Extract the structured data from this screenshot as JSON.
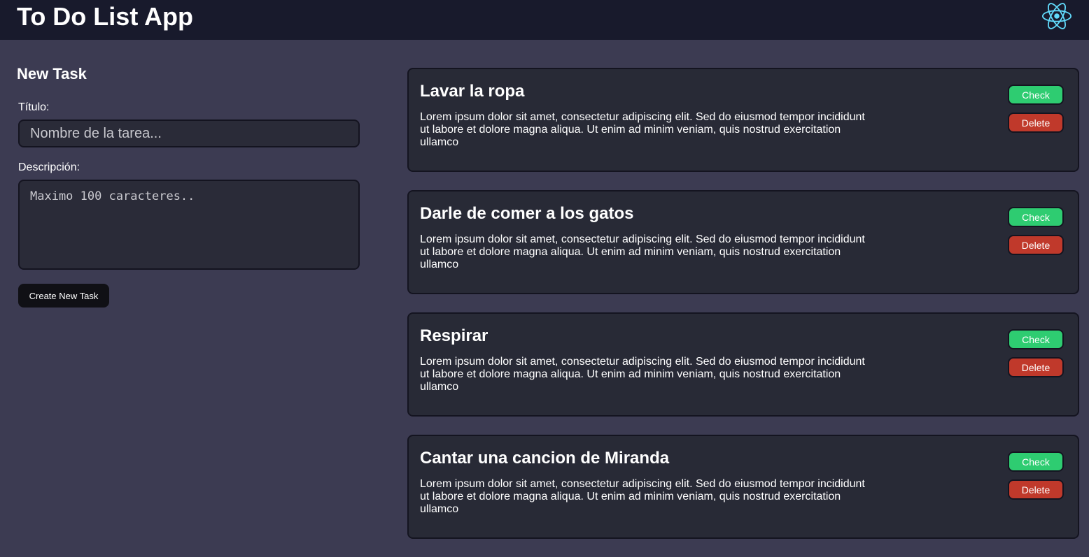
{
  "header": {
    "title": "To Do List App",
    "logo_icon": "react-logo-icon",
    "logo_color": "#61dafb",
    "background": "#181a2c"
  },
  "new_task": {
    "heading": "New Task",
    "title_label": "Título:",
    "title_placeholder": "Nombre de la tarea...",
    "title_value": "",
    "description_label": "Descripción:",
    "description_placeholder": "Maximo 100 caracteres..",
    "description_value": "",
    "create_button_label": "Create New Task"
  },
  "tasks": [
    {
      "title": "Lavar la ropa",
      "description": "Lorem ipsum dolor sit amet, consectetur adipiscing elit. Sed do eiusmod tempor incididunt ut labore et dolore magna aliqua. Ut enim ad minim veniam, quis nostrud exercitation ullamco",
      "check_label": "Check",
      "delete_label": "Delete"
    },
    {
      "title": "Darle de comer a los gatos",
      "description": "Lorem ipsum dolor sit amet, consectetur adipiscing elit. Sed do eiusmod tempor incididunt ut labore et dolore magna aliqua. Ut enim ad minim veniam, quis nostrud exercitation ullamco",
      "check_label": "Check",
      "delete_label": "Delete"
    },
    {
      "title": "Respirar",
      "description": "Lorem ipsum dolor sit amet, consectetur adipiscing elit. Sed do eiusmod tempor incididunt ut labore et dolore magna aliqua. Ut enim ad minim veniam, quis nostrud exercitation ullamco",
      "check_label": "Check",
      "delete_label": "Delete"
    },
    {
      "title": "Cantar una cancion de Miranda",
      "description": "Lorem ipsum dolor sit amet, consectetur adipiscing elit. Sed do eiusmod tempor incididunt ut labore et dolore magna aliqua. Ut enim ad minim veniam, quis nostrud exercitation ullamco",
      "check_label": "Check",
      "delete_label": "Delete"
    }
  ],
  "colors": {
    "page_background": "#3c3b52",
    "card_background": "#282a36",
    "check_button": "#2ecc71",
    "delete_button": "#c0392b",
    "create_button": "#101015"
  }
}
